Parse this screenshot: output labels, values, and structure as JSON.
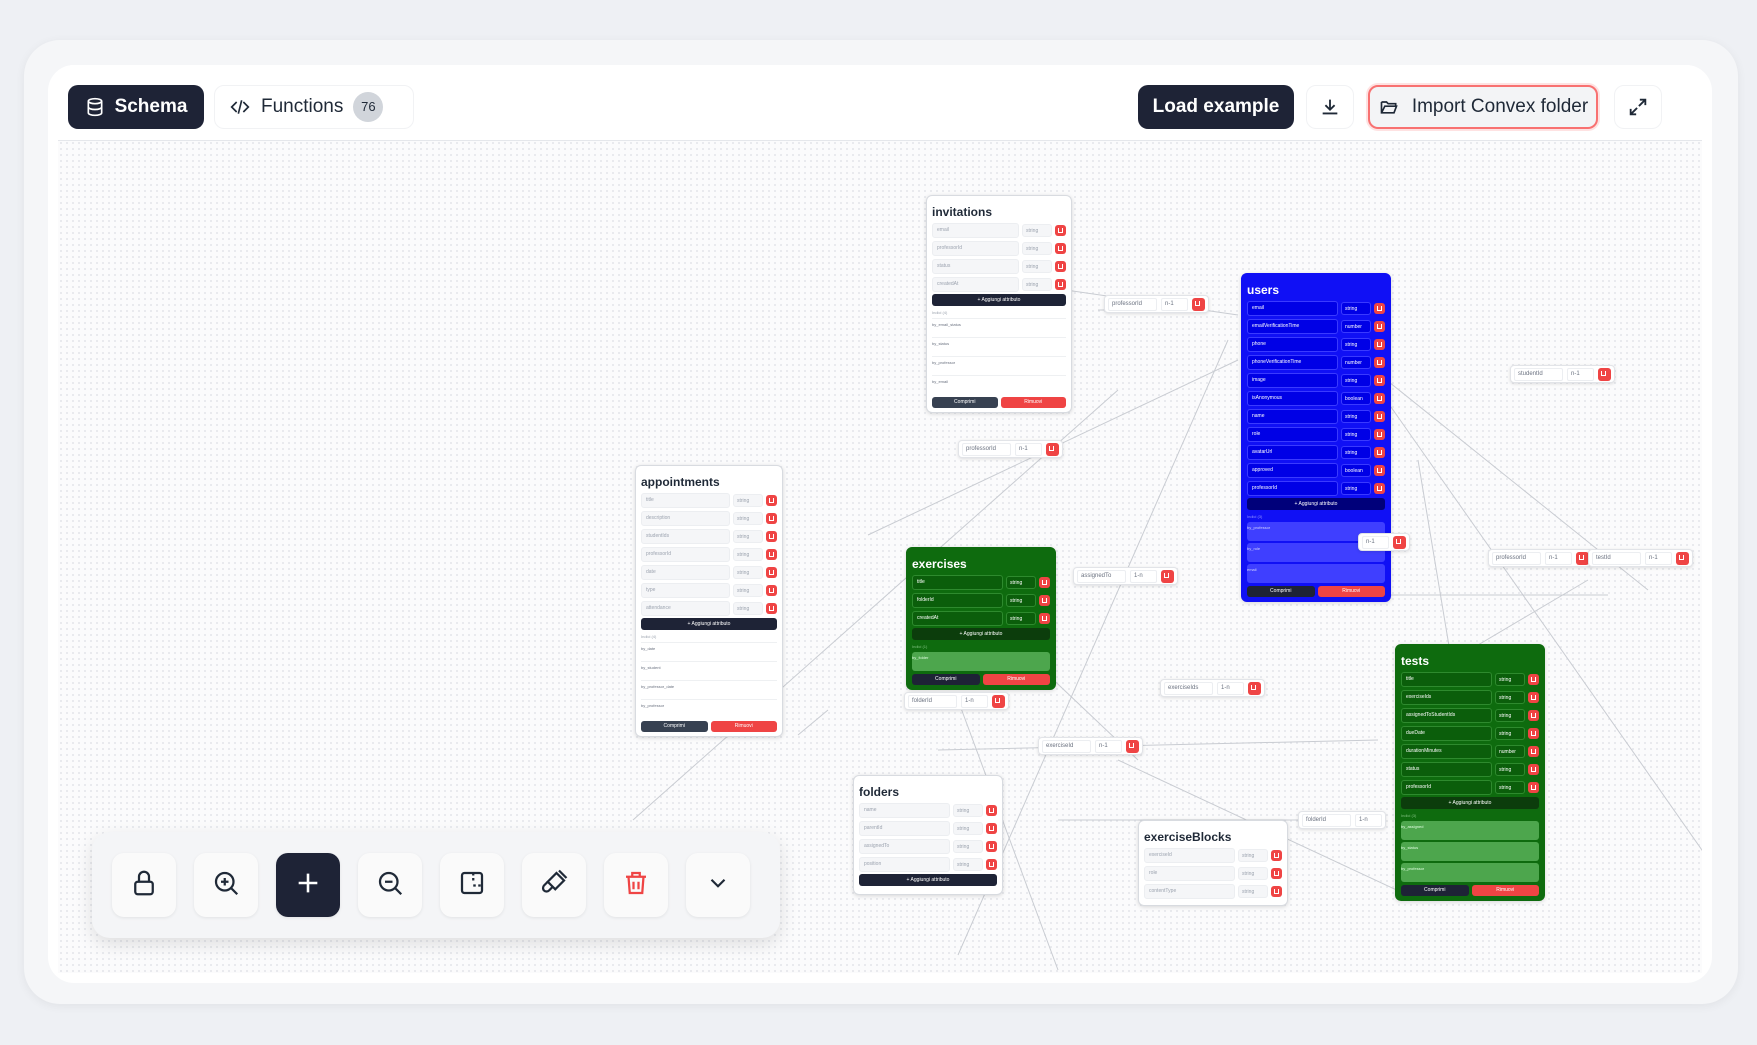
{
  "header": {
    "tabs": [
      {
        "label": "Schema",
        "icon": "database-icon",
        "active": true
      },
      {
        "label": "Functions",
        "icon": "code-icon",
        "badge": "76"
      }
    ],
    "load_example_label": "Load example",
    "import_label": "Import Convex folder",
    "accent_dark": "#1e2336",
    "accent_red": "#ef4444"
  },
  "tables": {
    "invitations": {
      "name": "invitations",
      "fields": [
        {
          "name": "email",
          "type": "string"
        },
        {
          "name": "professorId",
          "type": "string"
        },
        {
          "name": "status",
          "type": "string"
        },
        {
          "name": "createdAt",
          "type": "string"
        }
      ],
      "add_label": "+ Aggiungi attributo",
      "index_header": "Indici (4)",
      "indexes": [
        "by_email_status",
        "by_status",
        "by_professor",
        "by_email"
      ],
      "compress_label": "Comprimi",
      "remove_label": "Rimuovi"
    },
    "users": {
      "name": "users",
      "color": "#1010f5",
      "fields": [
        {
          "name": "email",
          "type": "string"
        },
        {
          "name": "emailVerificationTime",
          "type": "number"
        },
        {
          "name": "phone",
          "type": "string"
        },
        {
          "name": "phoneVerificationTime",
          "type": "number"
        },
        {
          "name": "image",
          "type": "string"
        },
        {
          "name": "isAnonymous",
          "type": "boolean"
        },
        {
          "name": "name",
          "type": "string"
        },
        {
          "name": "role",
          "type": "string"
        },
        {
          "name": "avatarUrl",
          "type": "string"
        },
        {
          "name": "approved",
          "type": "boolean"
        },
        {
          "name": "professorId",
          "type": "string"
        }
      ],
      "add_label": "+ Aggiungi attributo",
      "index_header": "Indici (3)",
      "indexes": [
        "by_professor",
        "by_role",
        "email"
      ],
      "compress_label": "Comprimi",
      "remove_label": "Rimuovi"
    },
    "appointments": {
      "name": "appointments",
      "fields": [
        {
          "name": "title",
          "type": "string"
        },
        {
          "name": "description",
          "type": "string"
        },
        {
          "name": "studentIds",
          "type": "string"
        },
        {
          "name": "professorId",
          "type": "string"
        },
        {
          "name": "date",
          "type": "string"
        },
        {
          "name": "type",
          "type": "string"
        },
        {
          "name": "attendance",
          "type": "string"
        }
      ],
      "add_label": "+ Aggiungi attributo",
      "index_header": "Indici (4)",
      "indexes": [
        "by_date",
        "by_student",
        "by_professor_date",
        "by_professor"
      ],
      "compress_label": "Comprimi",
      "remove_label": "Rimuovi"
    },
    "exercises": {
      "name": "exercises",
      "color": "#0e6b0e",
      "fields": [
        {
          "name": "title",
          "type": "string"
        },
        {
          "name": "folderId",
          "type": "string"
        },
        {
          "name": "createdAt",
          "type": "string"
        }
      ],
      "add_label": "+ Aggiungi attributo",
      "index_header": "Indici (1)",
      "indexes": [
        "by_folder"
      ],
      "compress_label": "Comprimi",
      "remove_label": "Rimuovi"
    },
    "tests": {
      "name": "tests",
      "color": "#0e6b0e",
      "fields": [
        {
          "name": "title",
          "type": "string"
        },
        {
          "name": "exerciseIds",
          "type": "string"
        },
        {
          "name": "assignedToStudentIds",
          "type": "string"
        },
        {
          "name": "dueDate",
          "type": "string"
        },
        {
          "name": "durationMinutes",
          "type": "number"
        },
        {
          "name": "status",
          "type": "string"
        },
        {
          "name": "professorId",
          "type": "string"
        }
      ],
      "add_label": "+ Aggiungi attributo",
      "index_header": "Indici (3)",
      "indexes": [
        "by_assigned",
        "by_status",
        "by_professor"
      ],
      "compress_label": "Comprimi",
      "remove_label": "Rimuovi"
    },
    "folders": {
      "name": "folders",
      "fields": [
        {
          "name": "name",
          "type": "string"
        },
        {
          "name": "parentId",
          "type": "string"
        },
        {
          "name": "assignedTo",
          "type": "string"
        },
        {
          "name": "position",
          "type": "string"
        }
      ],
      "add_label": "+ Aggiungi attributo"
    },
    "exerciseBlocks": {
      "name": "exerciseBlocks",
      "fields": [
        {
          "name": "exerciseId",
          "type": "string"
        },
        {
          "name": "role",
          "type": "string"
        },
        {
          "name": "contentType",
          "type": "string"
        }
      ]
    }
  },
  "relations": [
    {
      "field": "professorId",
      "rel": "n-1"
    },
    {
      "field": "professorId",
      "rel": "n-1"
    },
    {
      "field": "studentId",
      "rel": "n-1"
    },
    {
      "field": "assignedTo",
      "rel": "1-n"
    },
    {
      "field": "n-1",
      "rel": ""
    },
    {
      "field": "professorId",
      "rel": "n-1"
    },
    {
      "field": "testId",
      "rel": "n-1"
    },
    {
      "field": "folderId",
      "rel": "1-n"
    },
    {
      "field": "exerciseIds",
      "rel": "1-n"
    },
    {
      "field": "exerciseId",
      "rel": "n-1"
    },
    {
      "field": "folderId",
      "rel": "1-n"
    }
  ],
  "bottom_toolbar": [
    {
      "icon": "lock-icon"
    },
    {
      "icon": "zoom-in-icon"
    },
    {
      "icon": "plus-icon",
      "active": true
    },
    {
      "icon": "zoom-out-icon"
    },
    {
      "icon": "frame-icon"
    },
    {
      "icon": "brush-icon"
    },
    {
      "icon": "trash-icon"
    },
    {
      "icon": "chevron-down-icon"
    }
  ]
}
